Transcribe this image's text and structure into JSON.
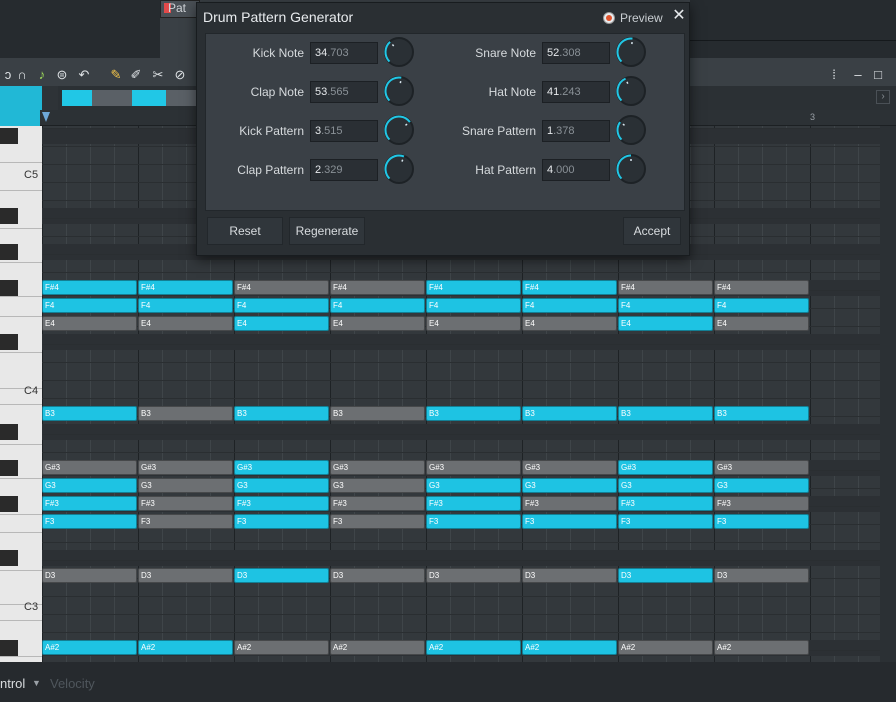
{
  "background": {
    "tab_label": "Pat",
    "piano_labels": [
      "C5",
      "C4",
      "C3"
    ],
    "timeline_bar": "3",
    "bottom_control": "ntrol",
    "bottom_velocity": "Velocity"
  },
  "dialog": {
    "title": "Drum Pattern Generator",
    "preview_label": "Preview",
    "close_icon": "close-icon",
    "params": [
      {
        "label": "Kick Note",
        "int": "34",
        "frac": ".703",
        "level": 0.347
      },
      {
        "label": "Snare Note",
        "int": "52",
        "frac": ".308",
        "level": 0.523
      },
      {
        "label": "Clap Note",
        "int": "53",
        "frac": ".565",
        "level": 0.536
      },
      {
        "label": "Hat Note",
        "int": "41",
        "frac": ".243",
        "level": 0.412
      },
      {
        "label": "Kick Pattern",
        "int": "3",
        "frac": ".515",
        "level": 0.7
      },
      {
        "label": "Snare Pattern",
        "int": "1",
        "frac": ".378",
        "level": 0.3
      },
      {
        "label": "Clap Pattern",
        "int": "2",
        "frac": ".329",
        "level": 0.58
      },
      {
        "label": "Hat Pattern",
        "int": "4",
        "frac": ".000",
        "level": 0.5
      }
    ],
    "buttons": {
      "reset": "Reset",
      "regenerate": "Regenerate",
      "accept": "Accept"
    }
  },
  "colors": {
    "note_on": "#1ec3e3",
    "note_off": "#6c6f72",
    "accent": "#21c7e6"
  },
  "note_rows": [
    {
      "name": "F#4",
      "pattern": [
        1,
        1,
        0,
        0,
        1,
        1,
        0,
        0
      ]
    },
    {
      "name": "F4",
      "pattern": [
        1,
        1,
        1,
        1,
        1,
        1,
        1,
        1
      ]
    },
    {
      "name": "E4",
      "pattern": [
        0,
        0,
        1,
        0,
        0,
        0,
        1,
        0
      ]
    },
    {
      "name": "B3",
      "pattern": [
        1,
        0,
        1,
        0,
        1,
        1,
        1,
        1
      ]
    },
    {
      "name": "G#3",
      "pattern": [
        0,
        0,
        1,
        0,
        0,
        0,
        1,
        0
      ]
    },
    {
      "name": "G3",
      "pattern": [
        1,
        0,
        1,
        0,
        1,
        1,
        1,
        1
      ]
    },
    {
      "name": "F#3",
      "pattern": [
        1,
        0,
        1,
        0,
        1,
        0,
        1,
        0
      ]
    },
    {
      "name": "F3",
      "pattern": [
        1,
        0,
        1,
        0,
        1,
        1,
        1,
        1
      ]
    },
    {
      "name": "D3",
      "pattern": [
        0,
        0,
        1,
        0,
        0,
        0,
        1,
        0
      ]
    },
    {
      "name": "A#2",
      "pattern": [
        1,
        1,
        0,
        0,
        1,
        1,
        0,
        0
      ]
    }
  ]
}
